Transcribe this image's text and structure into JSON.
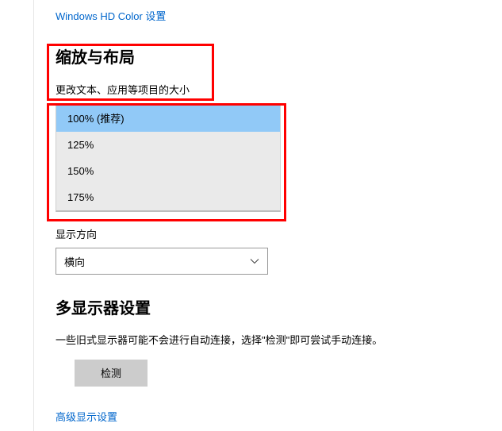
{
  "top_link": "Windows HD Color 设置",
  "scale_section": {
    "heading": "缩放与布局",
    "label": "更改文本、应用等项目的大小",
    "options": [
      "100% (推荐)",
      "125%",
      "150%",
      "175%"
    ],
    "selected_index": 0
  },
  "orientation": {
    "label": "显示方向",
    "value": "横向"
  },
  "multi_monitor": {
    "heading": "多显示器设置",
    "description": "一些旧式显示器可能不会进行自动连接，选择\"检测\"即可尝试手动连接。",
    "detect_button": "检测"
  },
  "advanced_link": "高级显示设置"
}
